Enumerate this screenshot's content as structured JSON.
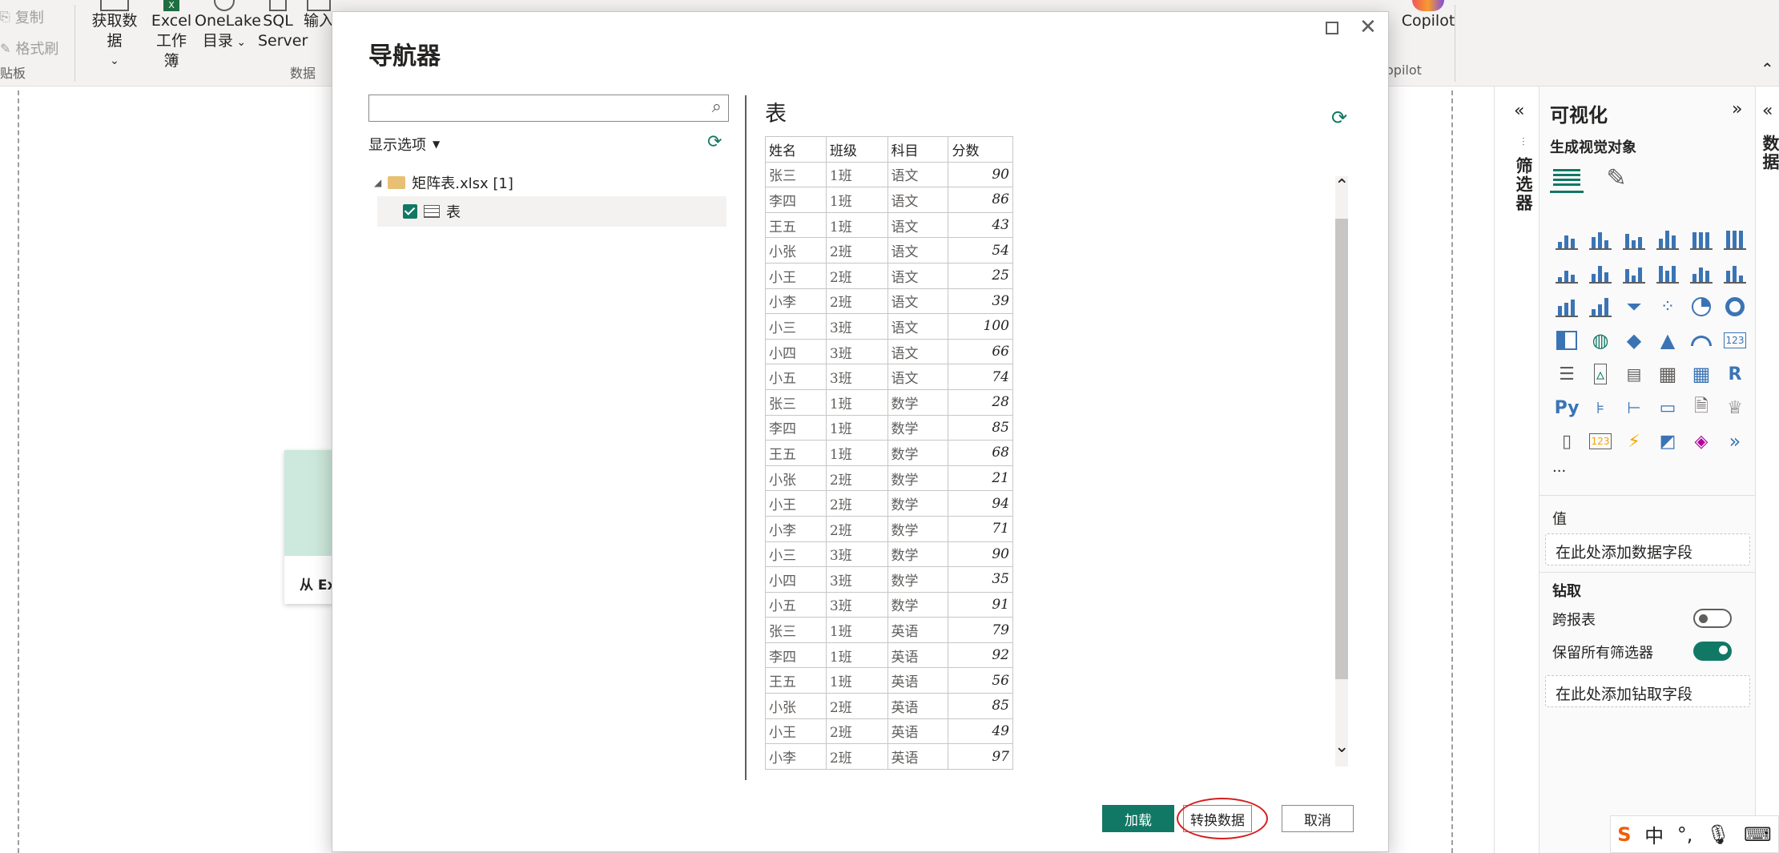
{
  "ribbon": {
    "clipboard": {
      "copy": "复制",
      "format_painter": "格式刷",
      "group": "贴板"
    },
    "data": {
      "get_data": "获取数据",
      "excel_line1": "Excel",
      "excel_line2": "工作簿",
      "onelake_line1": "OneLake",
      "onelake_line2": "目录",
      "sql_line1": "SQL",
      "sql_line2": "Server",
      "enter": "输入",
      "group": "数据"
    },
    "copilot": {
      "label": "Copilot",
      "group": "opilot"
    }
  },
  "canvas": {
    "welcome_card_text": "从 Excel"
  },
  "filters": {
    "label": "筛选器"
  },
  "visualizations": {
    "title": "可视化",
    "build_visual": "生成视觉对象",
    "more": "···",
    "values_label": "值",
    "values_placeholder": "在此处添加数据字段",
    "drill_label": "钻取",
    "cross_report": "跨报表",
    "cross_report_on": false,
    "keep_filters": "保留所有筛选器",
    "keep_filters_on": true,
    "drill_placeholder": "在此处添加钻取字段"
  },
  "data_pane": {
    "label": "数据"
  },
  "navigator": {
    "title": "导航器",
    "search_placeholder": "",
    "display_options": "显示选项",
    "tree": {
      "file": "矩阵表.xlsx [1]",
      "table": "表"
    },
    "preview_title": "表",
    "columns": [
      "姓名",
      "班级",
      "科目",
      "分数"
    ],
    "rows": [
      [
        "张三",
        "1班",
        "语文",
        "90"
      ],
      [
        "李四",
        "1班",
        "语文",
        "86"
      ],
      [
        "王五",
        "1班",
        "语文",
        "43"
      ],
      [
        "小张",
        "2班",
        "语文",
        "54"
      ],
      [
        "小王",
        "2班",
        "语文",
        "25"
      ],
      [
        "小李",
        "2班",
        "语文",
        "39"
      ],
      [
        "小三",
        "3班",
        "语文",
        "100"
      ],
      [
        "小四",
        "3班",
        "语文",
        "66"
      ],
      [
        "小五",
        "3班",
        "语文",
        "74"
      ],
      [
        "张三",
        "1班",
        "数学",
        "28"
      ],
      [
        "李四",
        "1班",
        "数学",
        "85"
      ],
      [
        "王五",
        "1班",
        "数学",
        "68"
      ],
      [
        "小张",
        "2班",
        "数学",
        "21"
      ],
      [
        "小王",
        "2班",
        "数学",
        "94"
      ],
      [
        "小李",
        "2班",
        "数学",
        "71"
      ],
      [
        "小三",
        "3班",
        "数学",
        "90"
      ],
      [
        "小四",
        "3班",
        "数学",
        "35"
      ],
      [
        "小五",
        "3班",
        "数学",
        "91"
      ],
      [
        "张三",
        "1班",
        "英语",
        "79"
      ],
      [
        "李四",
        "1班",
        "英语",
        "92"
      ],
      [
        "王五",
        "1班",
        "英语",
        "56"
      ],
      [
        "小张",
        "2班",
        "英语",
        "85"
      ],
      [
        "小王",
        "2班",
        "英语",
        "49"
      ],
      [
        "小李",
        "2班",
        "英语",
        "97"
      ]
    ],
    "buttons": {
      "load": "加载",
      "transform": "转换数据",
      "cancel": "取消"
    }
  },
  "ime": {
    "lang": "中"
  },
  "colors": {
    "accent": "#117865",
    "highlight": "#d81e1e"
  }
}
